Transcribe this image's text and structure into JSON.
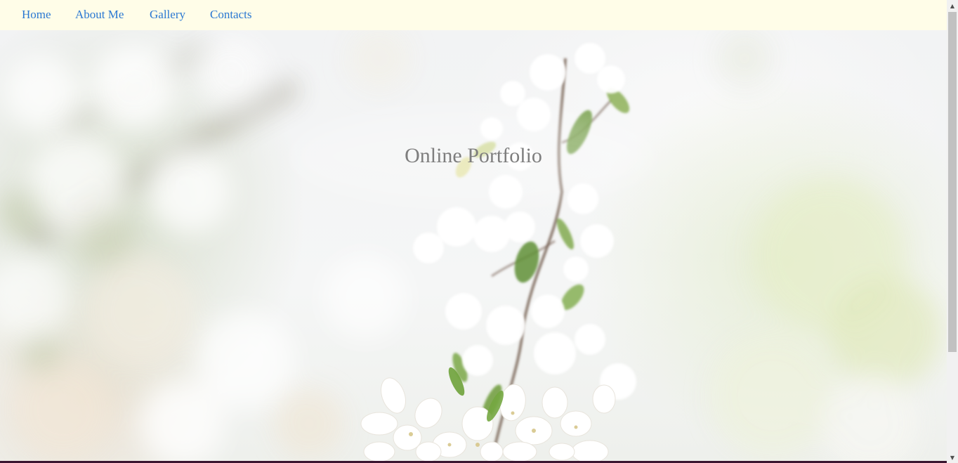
{
  "nav": {
    "items": [
      {
        "label": "Home"
      },
      {
        "label": "About Me"
      },
      {
        "label": "Gallery"
      },
      {
        "label": "Contacts"
      }
    ]
  },
  "hero": {
    "title": "Online Portfolio",
    "image": "blurred-white-blossom-branch"
  },
  "scrollbar": {
    "up_icon": "up-arrow-icon",
    "down_icon": "down-arrow-icon"
  },
  "colors": {
    "nav_background": "#fffde8",
    "nav_link": "#2a78d2",
    "title": "#7e7e7e",
    "bottom_border": "#3a1530"
  }
}
